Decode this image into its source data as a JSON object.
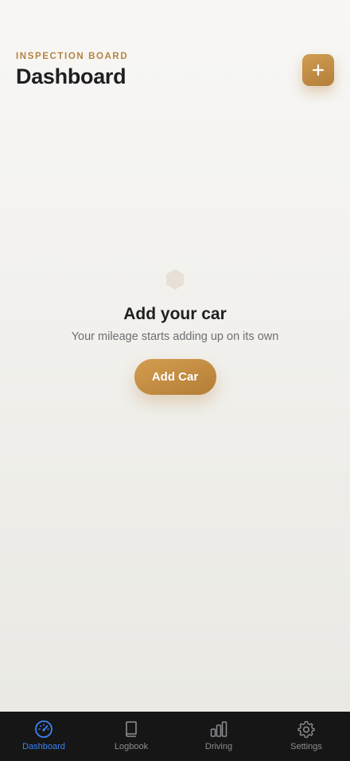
{
  "header": {
    "eyebrow": "INSPECTION BOARD",
    "title": "Dashboard",
    "add_button_icon": "plus-icon"
  },
  "empty_state": {
    "icon": "hexagon-icon",
    "title": "Add your car",
    "subtitle": "Your mileage starts adding up on its own",
    "button_label": "Add Car"
  },
  "tabbar": {
    "items": [
      {
        "label": "Dashboard",
        "icon": "speedometer-icon",
        "active": true
      },
      {
        "label": "Logbook",
        "icon": "book-icon",
        "active": false
      },
      {
        "label": "Driving",
        "icon": "bar-chart-icon",
        "active": false
      },
      {
        "label": "Settings",
        "icon": "gear-icon",
        "active": false
      }
    ]
  },
  "colors": {
    "accent": "#c08a45",
    "active_tab": "#3b82f6",
    "tabbar_bg": "#161616"
  }
}
